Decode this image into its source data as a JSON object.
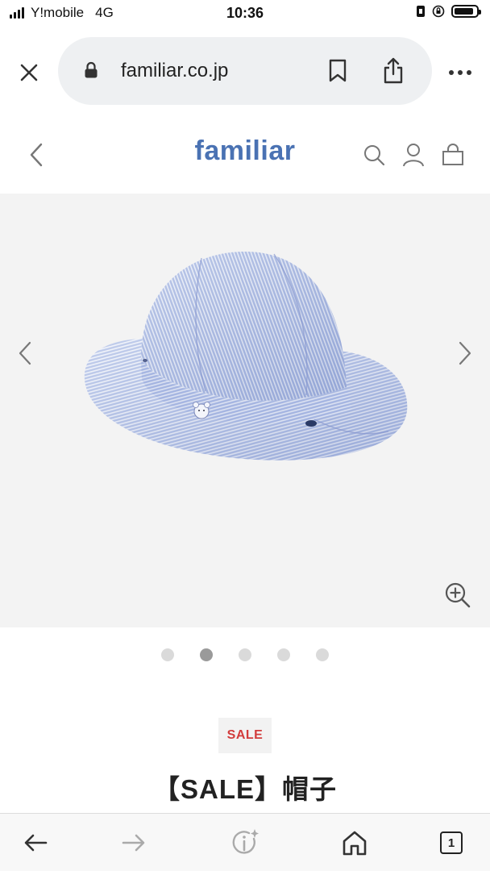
{
  "status_bar": {
    "carrier": "Y!mobile",
    "network": "4G",
    "time": "10:36",
    "battery_level": 0.9
  },
  "browser": {
    "url": "familiar.co.jp",
    "icons": [
      "close-icon",
      "lock-icon",
      "bookmark-icon",
      "share-icon",
      "more-icon"
    ]
  },
  "site_header": {
    "logo": "familiar",
    "logo_color": "#4a72b3",
    "icons": [
      "back-chevron-icon",
      "search-icon",
      "user-icon",
      "bag-icon"
    ]
  },
  "gallery": {
    "image": "blue striped bucket hat",
    "image_count": 5,
    "active_index": 1,
    "icons": [
      "chevron-left-icon",
      "chevron-right-icon",
      "zoom-in-icon"
    ]
  },
  "product": {
    "badge": "SALE",
    "badge_color": "#d23c3c",
    "title": "【SALE】帽子"
  },
  "toolbar": {
    "tab_count": "1",
    "icons": [
      "back-arrow-icon",
      "forward-arrow-icon",
      "info-sparkle-icon",
      "home-icon",
      "tabs-icon"
    ]
  }
}
